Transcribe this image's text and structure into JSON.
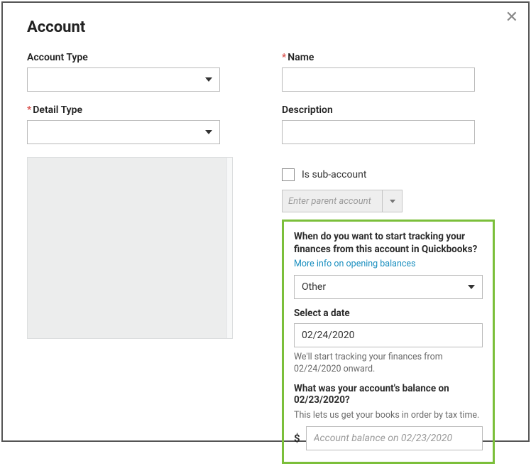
{
  "dialog": {
    "title": "Account"
  },
  "labels": {
    "account_type": "Account Type",
    "detail_type": "Detail Type",
    "name": "Name",
    "description": "Description",
    "is_sub": "Is sub-account",
    "parent_placeholder": "Enter parent account"
  },
  "green": {
    "q1": "When do you want to start tracking your finances from this account in Quickbooks?",
    "more_info": "More info on opening balances",
    "tracking_option": "Other",
    "select_date_label": "Select a date",
    "date_value": "02/24/2020",
    "tracking_helper": "We'll start tracking your finances from 02/24/2020 onward.",
    "balance_q": "What was your account's balance on 02/23/2020?",
    "balance_helper": "This lets us get your books in order by tax time.",
    "currency_symbol": "$",
    "balance_placeholder": "Account balance on 02/23/2020"
  }
}
